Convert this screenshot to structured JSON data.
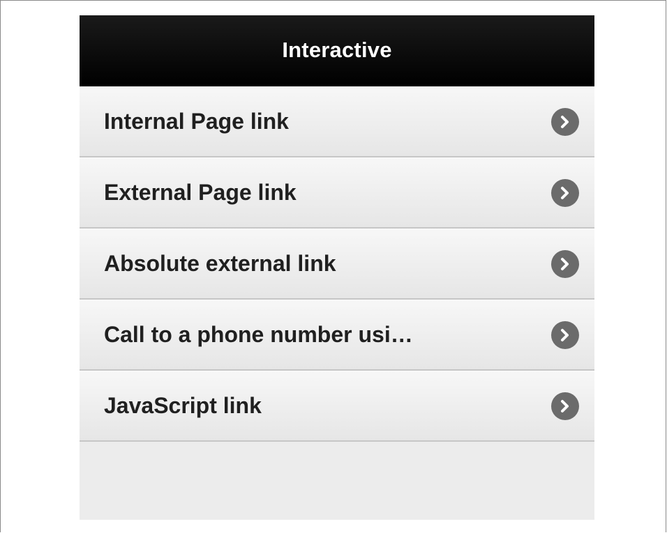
{
  "header": {
    "title": "Interactive"
  },
  "list": {
    "items": [
      {
        "label": "Internal Page link",
        "icon": "chevron-right-icon"
      },
      {
        "label": "External Page link",
        "icon": "chevron-right-icon"
      },
      {
        "label": "Absolute external link",
        "icon": "chevron-right-icon"
      },
      {
        "label": "Call to a phone number usi…",
        "icon": "chevron-right-icon"
      },
      {
        "label": "JavaScript link",
        "icon": "chevron-right-icon"
      }
    ]
  },
  "colors": {
    "header_bg": "#000000",
    "header_text": "#ffffff",
    "list_bg": "#ececec",
    "icon_bg": "#6b6b6b",
    "label_text": "#202020"
  }
}
